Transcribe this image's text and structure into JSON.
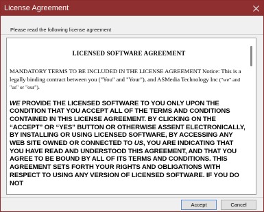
{
  "window": {
    "title": "License Agreement",
    "title_bar_color": "#8f2f2f"
  },
  "instructions": "Please read the following license agreement",
  "license": {
    "heading": "LICENSED SOFTWARE AGREEMENT",
    "para1_main": "MANDATORY TERMS TO BE INCLUDED IN THE LICENSE AGREEMENT Notice: This is a legally binding contract between you (\"You\" and \"Your\"), and ",
    "para1_company": "ASMedia Technology Inc",
    "para1_tail": " (\"we\" and \"us\" or \"our\").",
    "para2_we": "WE",
    "para2_a": " PROVIDE THE LICENSED SOFTWARE TO YOU ONLY UPON THE CONDITION THAT YOU ACCEPT ALL OF THE TERMS AND CONDITIONS CONTAINED IN THIS LICENSE AGREEMENT. BY CLICKING ON THE “ACCEPT” OR “YES” BUTTON OR OTHERWISE ASSENT ELECTRONICALLY, BY INSTALLING OR USING LICENSED SOFTWARE, BY ACCESSING ANY WEB SITE OWNED OR CONNECTED TO ",
    "para2_us": "US",
    "para2_b": ", YOU ARE INDICATING THAT YOU HAVE READ AND UNDERSTOOD THIS AGREEMENT, AND THAT YOU AGREE TO BE BOUND BY ALL OF ITS TERMS AND CONDITIONS. THIS AGREEMENT SETS FORTH YOUR RIGHTS AND OBLIGATIONS WITH RESPECT TO USING ANY VERSION OF LICENSED SOFTWARE. IF YOU DO NOT"
  },
  "buttons": {
    "accept": "Accept",
    "cancel": "Cancel"
  },
  "icons": {
    "close": "close-icon"
  }
}
